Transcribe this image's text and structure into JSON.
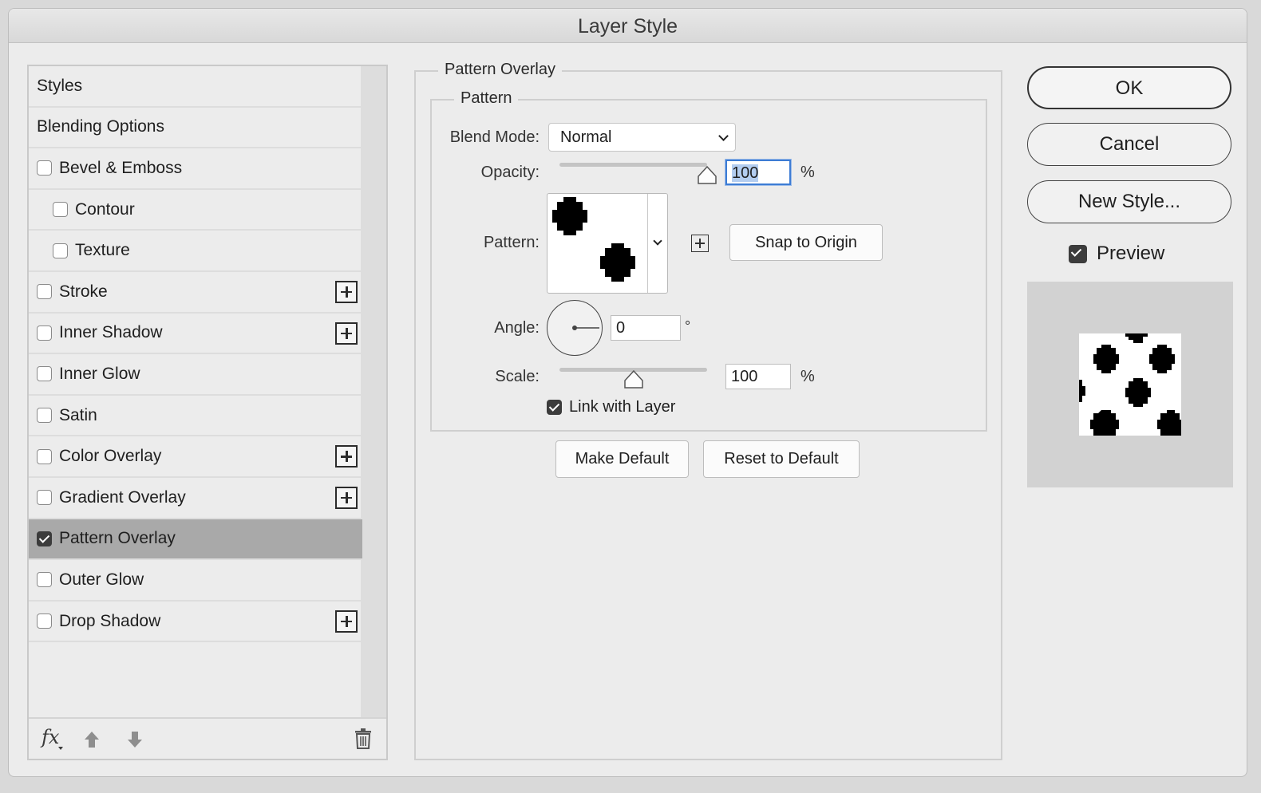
{
  "window": {
    "title": "Layer Style"
  },
  "sidebar": {
    "items": [
      {
        "label": "Styles",
        "checkbox": false,
        "checked": false,
        "indent": false,
        "plus": false,
        "selected": false
      },
      {
        "label": "Blending Options",
        "checkbox": false,
        "checked": false,
        "indent": false,
        "plus": false,
        "selected": false
      },
      {
        "label": "Bevel & Emboss",
        "checkbox": true,
        "checked": false,
        "indent": false,
        "plus": false,
        "selected": false
      },
      {
        "label": "Contour",
        "checkbox": true,
        "checked": false,
        "indent": true,
        "plus": false,
        "selected": false
      },
      {
        "label": "Texture",
        "checkbox": true,
        "checked": false,
        "indent": true,
        "plus": false,
        "selected": false
      },
      {
        "label": "Stroke",
        "checkbox": true,
        "checked": false,
        "indent": false,
        "plus": true,
        "selected": false
      },
      {
        "label": "Inner Shadow",
        "checkbox": true,
        "checked": false,
        "indent": false,
        "plus": true,
        "selected": false
      },
      {
        "label": "Inner Glow",
        "checkbox": true,
        "checked": false,
        "indent": false,
        "plus": false,
        "selected": false
      },
      {
        "label": "Satin",
        "checkbox": true,
        "checked": false,
        "indent": false,
        "plus": false,
        "selected": false
      },
      {
        "label": "Color Overlay",
        "checkbox": true,
        "checked": false,
        "indent": false,
        "plus": true,
        "selected": false
      },
      {
        "label": "Gradient Overlay",
        "checkbox": true,
        "checked": false,
        "indent": false,
        "plus": true,
        "selected": false
      },
      {
        "label": "Pattern Overlay",
        "checkbox": true,
        "checked": true,
        "indent": false,
        "plus": false,
        "selected": true
      },
      {
        "label": "Outer Glow",
        "checkbox": true,
        "checked": false,
        "indent": false,
        "plus": false,
        "selected": false
      },
      {
        "label": "Drop Shadow",
        "checkbox": true,
        "checked": false,
        "indent": false,
        "plus": true,
        "selected": false
      }
    ],
    "footer": {
      "fx_label": "fx",
      "icons": [
        "fx-icon",
        "move-up-icon",
        "move-down-icon",
        "trash-icon"
      ]
    }
  },
  "panel": {
    "section_title": "Pattern Overlay",
    "group_title": "Pattern",
    "blend_mode": {
      "label": "Blend Mode:",
      "value": "Normal"
    },
    "opacity": {
      "label": "Opacity:",
      "value": "100",
      "unit": "%",
      "level": 1.0
    },
    "pattern": {
      "label": "Pattern:",
      "new_preset_icon": "plus-square-icon"
    },
    "snap_to_origin": "Snap to Origin",
    "angle": {
      "label": "Angle:",
      "value": "0",
      "unit": "°"
    },
    "scale": {
      "label": "Scale:",
      "value": "100",
      "unit": "%",
      "level": 0.5
    },
    "link_with_layer": {
      "label": "Link with Layer",
      "checked": true
    },
    "make_default": "Make Default",
    "reset_to_default": "Reset to Default"
  },
  "actions": {
    "ok": "OK",
    "cancel": "Cancel",
    "new_style": "New Style...",
    "preview": {
      "label": "Preview",
      "checked": true
    }
  },
  "colors": {
    "window_bg": "#ececec",
    "selected_row": "#a9a9a9",
    "focus_blue": "#3d7cd4",
    "preview_bg": "#d2d2d2"
  }
}
